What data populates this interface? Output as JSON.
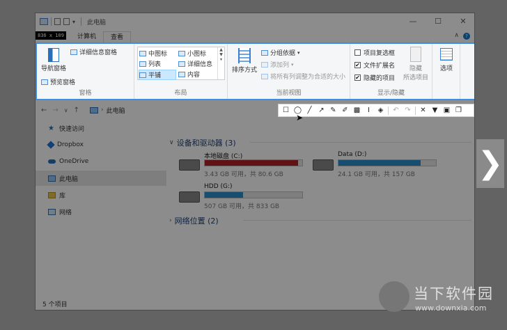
{
  "window": {
    "title": "此电脑",
    "controls": {
      "minimize": "—",
      "maximize": "☐",
      "close": "✕"
    },
    "dims_badge": "836 x 109",
    "tabs": [
      "计算机",
      "查看"
    ],
    "help": "?",
    "collapse": "∧"
  },
  "ribbon": {
    "pane_group": {
      "label": "窗格",
      "nav_pane": "导航窗格",
      "details_pane": "详细信息窗格",
      "preview_pane": "预览窗格"
    },
    "layout_group": {
      "label": "布局",
      "options": [
        "中图标",
        "小图标",
        "列表",
        "详细信息",
        "平铺",
        "内容"
      ],
      "selected": "平铺"
    },
    "current_view_group": {
      "label": "当前视图",
      "sort_by": "排序方式",
      "group_by": "分组依据",
      "add_column": "添加列",
      "fit_columns": "将所有列调整为合适的大小"
    },
    "show_hide_group": {
      "label": "显示/隐藏",
      "item_checkboxes": "项目复选框",
      "file_extensions": "文件扩展名",
      "hidden_items": "隐藏的项目",
      "item_checkboxes_checked": "",
      "file_extensions_checked": "✔",
      "hidden_items_checked": "✔",
      "hide_selected": "隐藏",
      "hide_selected_sub": "所选项目"
    },
    "options_label": "选项"
  },
  "address": {
    "back": "←",
    "forward": "→",
    "recent": "∨",
    "up": "↑",
    "path": "此电脑"
  },
  "annotation_toolbar": {
    "tools": [
      {
        "name": "rectangle-tool",
        "glyph": "☐"
      },
      {
        "name": "ellipse-tool",
        "glyph": "◯"
      },
      {
        "name": "line-tool",
        "glyph": "╱"
      },
      {
        "name": "arrow-tool",
        "glyph": "↗"
      },
      {
        "name": "pen-tool",
        "glyph": "✎"
      },
      {
        "name": "marker-tool",
        "glyph": "✐"
      },
      {
        "name": "mosaic-tool",
        "glyph": "▩"
      },
      {
        "name": "text-tool",
        "glyph": "I"
      },
      {
        "name": "eraser-tool",
        "glyph": "◈"
      },
      {
        "name": "undo-tool",
        "glyph": "↶"
      },
      {
        "name": "redo-tool",
        "glyph": "↷"
      },
      {
        "name": "cancel-tool",
        "glyph": "✕"
      },
      {
        "name": "pin-tool",
        "glyph": "▼"
      },
      {
        "name": "save-tool",
        "glyph": "▣"
      },
      {
        "name": "copy-tool",
        "glyph": "❐"
      }
    ]
  },
  "nav_pane": {
    "items": [
      "快速访问",
      "Dropbox",
      "OneDrive",
      "此电脑",
      "库",
      "网络"
    ],
    "selected": "此电脑"
  },
  "content": {
    "devices_header": "设备和驱动器 (3)",
    "network_header": "网络位置 (2)",
    "drives": [
      {
        "name": "本地磁盘 (C:)",
        "info": "3.43 GB 可用，共 80.6 GB",
        "used_fraction": 0.957,
        "color": "#b02126"
      },
      {
        "name": "Data (D:)",
        "info": "24.1 GB 可用，共 157 GB",
        "used_fraction": 0.846,
        "color": "#2a8dc8"
      },
      {
        "name": "HDD (G:)",
        "info": "507 GB 可用，共 833 GB",
        "used_fraction": 0.391,
        "color": "#2a8dc8"
      }
    ]
  },
  "status": {
    "items_count": "5 个项目"
  },
  "next_button": "❯",
  "watermark": {
    "text": "当下软件园",
    "url": "www.downxia.com"
  }
}
